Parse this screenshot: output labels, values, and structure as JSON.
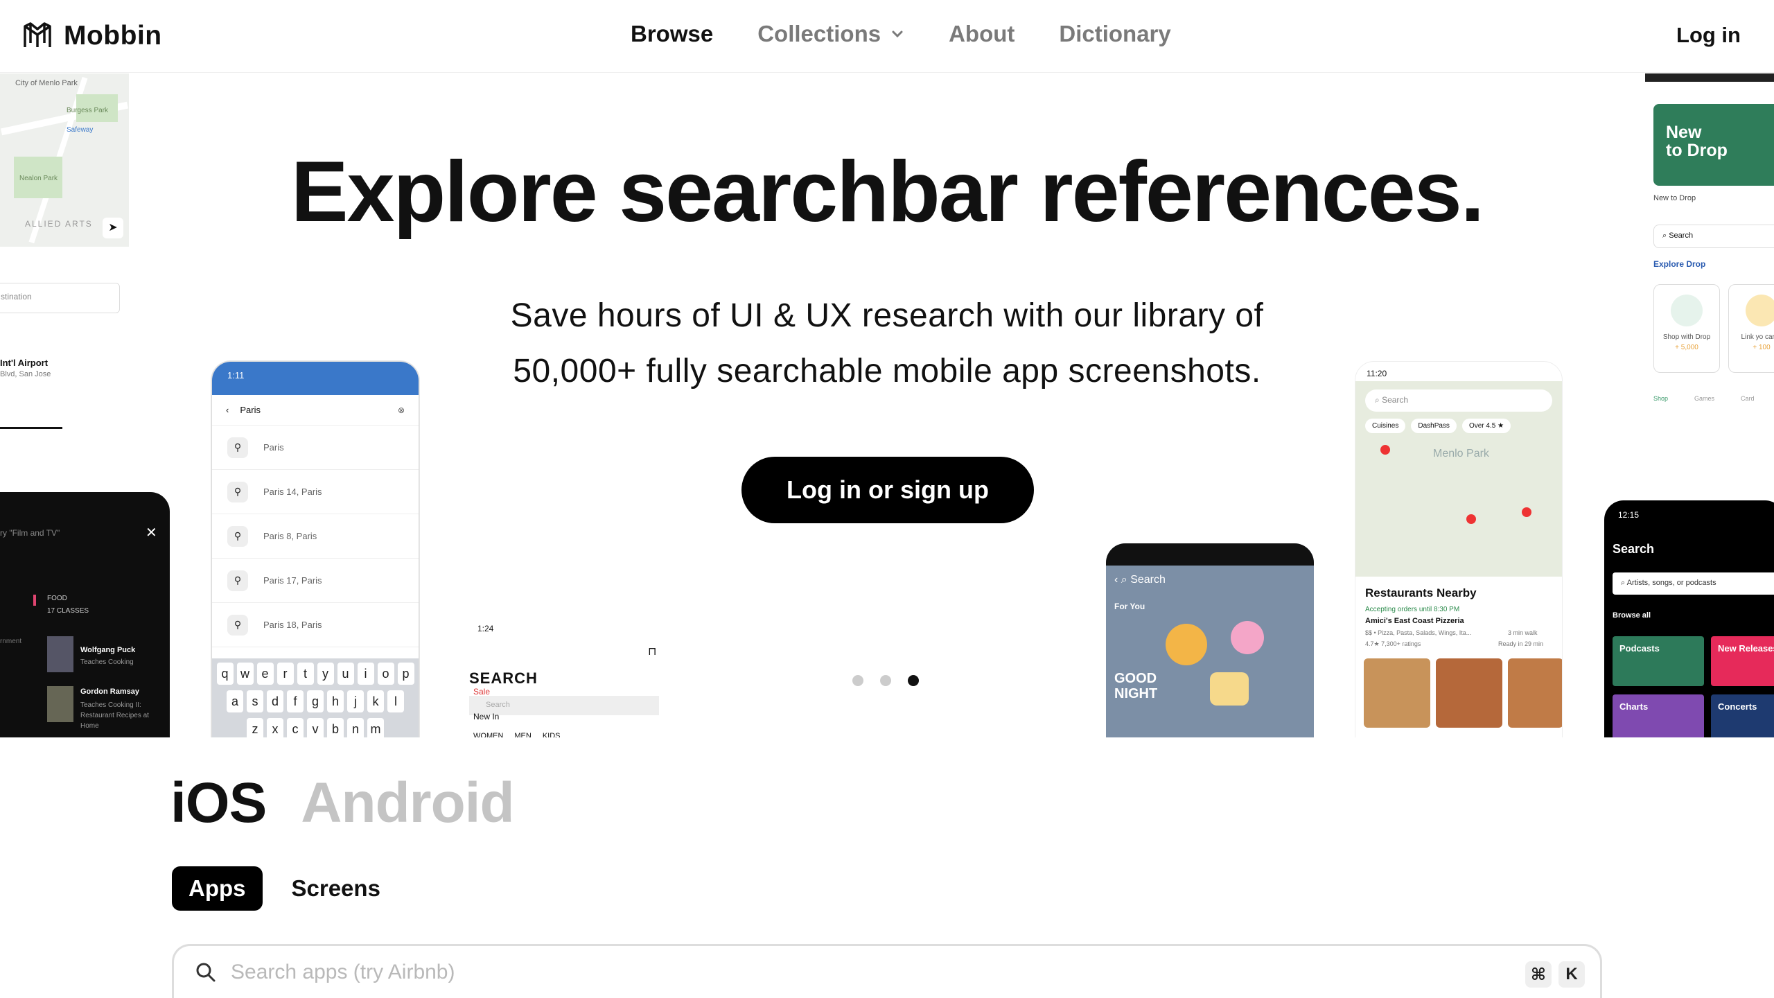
{
  "nav": {
    "brand": "Mobbin",
    "links": [
      {
        "label": "Browse"
      },
      {
        "label": "Collections"
      },
      {
        "label": "About"
      },
      {
        "label": "Dictionary"
      }
    ],
    "login": "Log in"
  },
  "hero": {
    "title": "Explore searchbar references.",
    "subtitle_line1": "Save hours of UI & UX research with our library of",
    "subtitle_line2": "50,000+ fully searchable mobile app screenshots.",
    "cta": "Log in or sign up",
    "carousel_active": 3,
    "carousel_count": 3
  },
  "cards": {
    "map_left": {
      "labels": [
        "City of Menlo Park",
        "Burgess Park",
        "Safeway",
        "Nealon Park",
        "ALLIED ARTS"
      ],
      "destination_placeholder": "stination",
      "airport": "Int'l Airport",
      "airport_addr": "Blvd, San Jose"
    },
    "dark_left": {
      "query": "ry \"Film and TV\"",
      "category": "FOOD",
      "classes": "17 CLASSES",
      "item1_name": "Wolfgang Puck",
      "item1_sub": "Teaches Cooking",
      "item2_name": "Gordon Ramsay",
      "item2_sub": "Teaches Cooking II: Restaurant Recipes at Home",
      "side_text": "rnment"
    },
    "paris": {
      "time": "1:11",
      "query": "Paris",
      "rows": [
        "Paris",
        "Paris 14, Paris",
        "Paris 8, Paris",
        "Paris 17, Paris",
        "Paris 18, Paris"
      ],
      "keys_row1": [
        "q",
        "w",
        "e",
        "r",
        "t",
        "y",
        "u",
        "i",
        "o",
        "p"
      ],
      "keys_row2": [
        "a",
        "s",
        "d",
        "f",
        "g",
        "h",
        "j",
        "k",
        "l"
      ],
      "keys_row3": [
        "z",
        "x",
        "c",
        "v",
        "b",
        "n",
        "m"
      ]
    },
    "shop": {
      "time": "1:24",
      "heading": "SEARCH",
      "placeholder": "Search",
      "tabs": [
        "WOMEN",
        "MEN",
        "KIDS"
      ],
      "rows": [
        "Sale",
        "New In"
      ]
    },
    "stickers": {
      "search": "Search",
      "section": "For You",
      "sticker_text": "GOOD NIGHT"
    },
    "restaurants": {
      "time": "11:20",
      "search": "Search",
      "chips": [
        "Cuisines",
        "DashPass",
        "Over 4.5 ★"
      ],
      "map_label": "Menlo Park",
      "heading": "Restaurants Nearby",
      "accepting": "Accepting orders until 8:30 PM",
      "name": "Amici's East Coast Pizzeria",
      "meta": "$$ • Pizza, Pasta, Salads, Wings, Ita...",
      "rating": "4.7★ 7,300+ ratings",
      "walk": "3 min walk",
      "ready": "Ready in 29 min"
    },
    "drop": {
      "banner1": "New",
      "banner2": "to Drop",
      "caption": "New to Drop",
      "search": "Search",
      "section": "Explore Drop",
      "tile1": "Shop with Drop",
      "tile1_pts": "+ 5,000",
      "tile2": "Link yo cards",
      "tile2_pts": "+ 100",
      "tabs": [
        "Shop",
        "Games",
        "Card"
      ]
    },
    "music": {
      "time": "12:15",
      "title": "Search",
      "placeholder": "Artists, songs, or podcasts",
      "browse": "Browse all",
      "tiles": [
        "Podcasts",
        "New Releases",
        "Charts",
        "Concerts"
      ]
    }
  },
  "platform": {
    "ios": "iOS",
    "android": "Android"
  },
  "tabs": [
    "Apps",
    "Screens"
  ],
  "search": {
    "placeholder": "Search apps (try Airbnb)",
    "kbd1": "⌘",
    "kbd2": "K"
  },
  "colors": {
    "primary": "#000000",
    "muted_nav": "#7a7a7a",
    "inactive_platform": "#c4c4c4"
  }
}
